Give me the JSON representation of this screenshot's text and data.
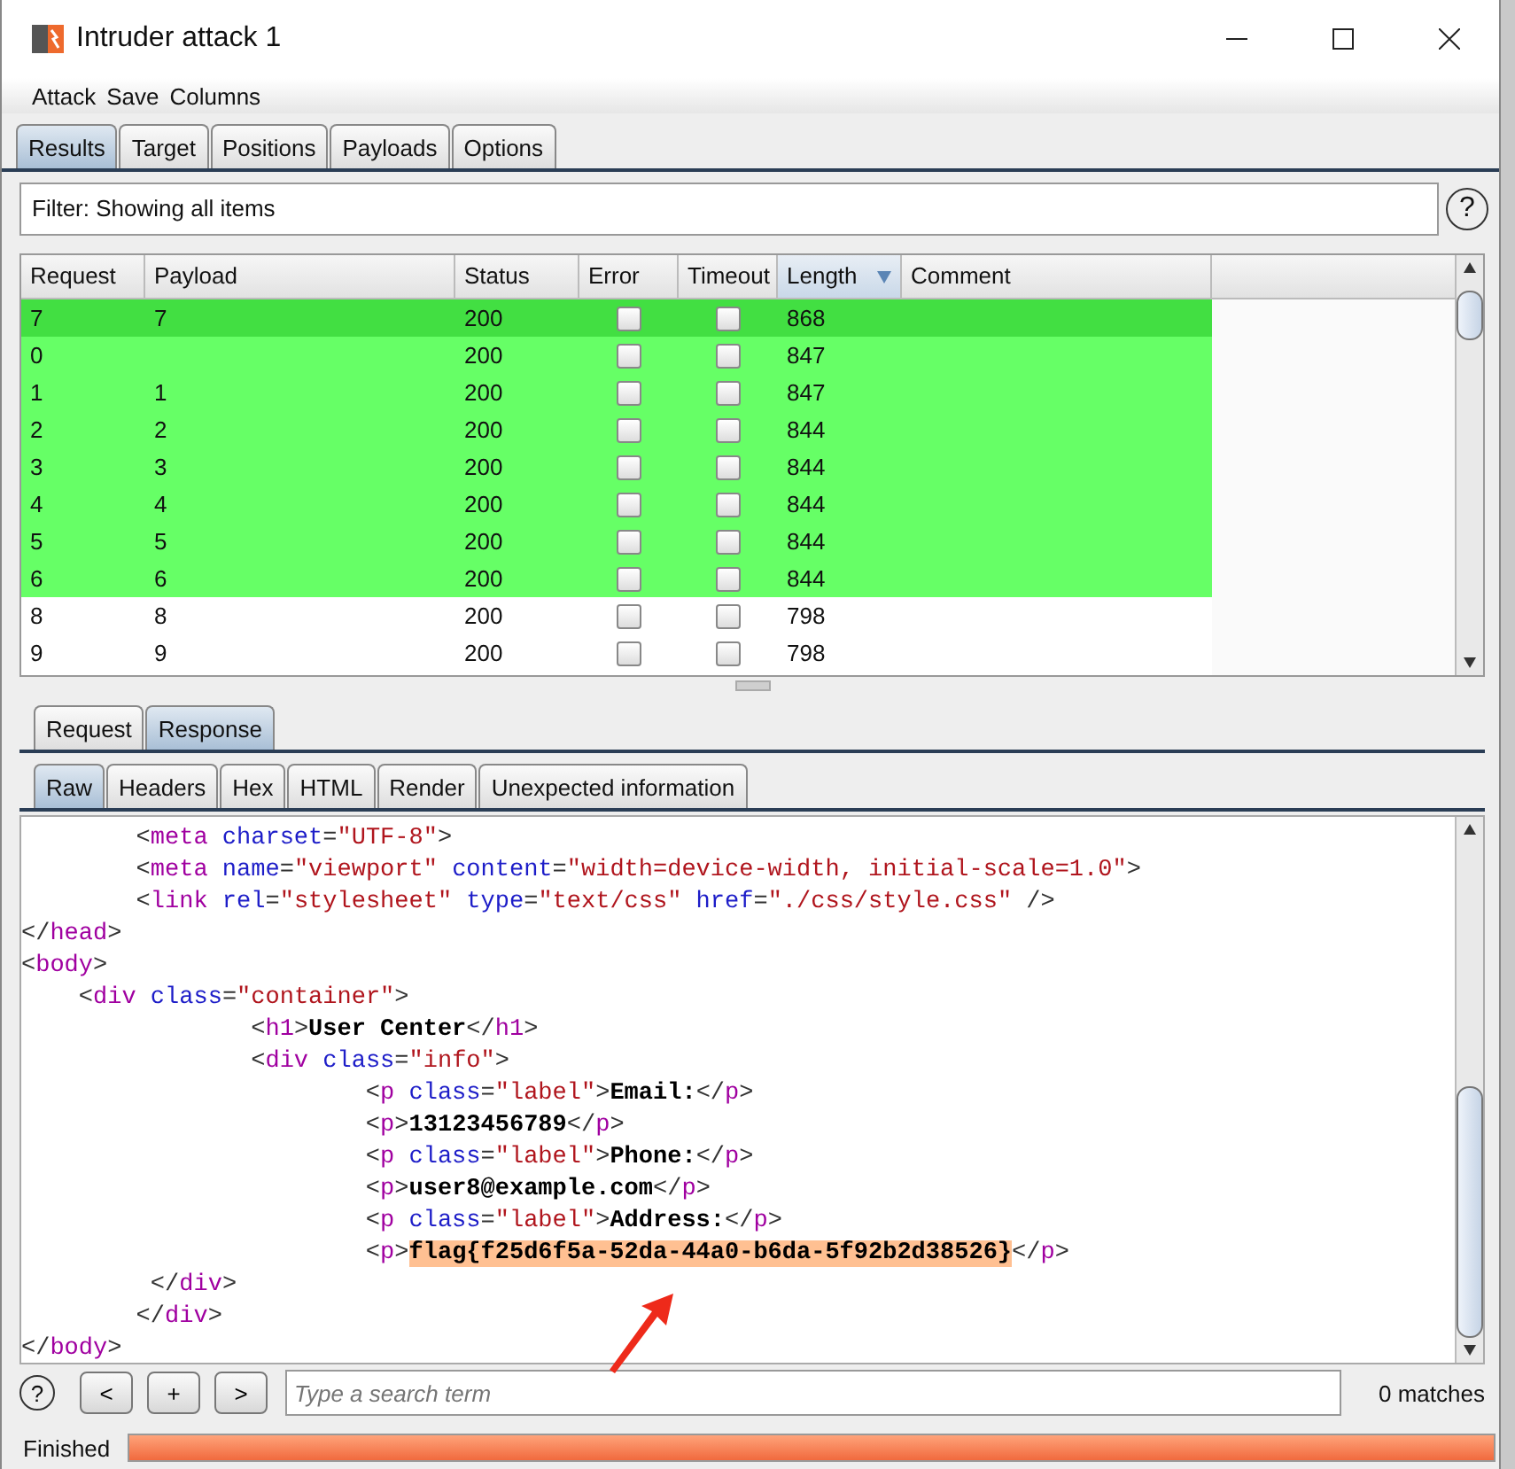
{
  "window": {
    "title": "Intruder attack 1"
  },
  "menu": [
    "Attack",
    "Save",
    "Columns"
  ],
  "tabs": [
    {
      "label": "Results",
      "selected": true
    },
    {
      "label": "Target",
      "selected": false
    },
    {
      "label": "Positions",
      "selected": false
    },
    {
      "label": "Payloads",
      "selected": false
    },
    {
      "label": "Options",
      "selected": false
    }
  ],
  "filter": {
    "text": "Filter: Showing all items",
    "help": "?"
  },
  "table": {
    "columns": [
      {
        "label": "Request",
        "sorted": false
      },
      {
        "label": "Payload",
        "sorted": false
      },
      {
        "label": "Status",
        "sorted": false
      },
      {
        "label": "Error",
        "sorted": false
      },
      {
        "label": "Timeout",
        "sorted": false
      },
      {
        "label": "Length",
        "sorted": true
      },
      {
        "label": "Comment",
        "sorted": false
      }
    ],
    "rows": [
      {
        "request": "7",
        "payload": "7",
        "status": "200",
        "error": false,
        "timeout": false,
        "length": "868",
        "color": "#42df42"
      },
      {
        "request": "0",
        "status": "200",
        "error": false,
        "timeout": false,
        "length": "847",
        "color": "#66ff66"
      },
      {
        "request": "1",
        "payload": "1",
        "status": "200",
        "error": false,
        "timeout": false,
        "length": "847",
        "color": "#66ff66"
      },
      {
        "request": "2",
        "payload": "2",
        "status": "200",
        "error": false,
        "timeout": false,
        "length": "844",
        "color": "#66ff66"
      },
      {
        "request": "3",
        "payload": "3",
        "status": "200",
        "error": false,
        "timeout": false,
        "length": "844",
        "color": "#66ff66"
      },
      {
        "request": "4",
        "payload": "4",
        "status": "200",
        "error": false,
        "timeout": false,
        "length": "844",
        "color": "#66ff66"
      },
      {
        "request": "5",
        "payload": "5",
        "status": "200",
        "error": false,
        "timeout": false,
        "length": "844",
        "color": "#66ff66"
      },
      {
        "request": "6",
        "payload": "6",
        "status": "200",
        "error": false,
        "timeout": false,
        "length": "844",
        "color": "#66ff66"
      },
      {
        "request": "8",
        "payload": "8",
        "status": "200",
        "error": false,
        "timeout": false,
        "length": "798",
        "color": "#ffffff"
      },
      {
        "request": "9",
        "payload": "9",
        "status": "200",
        "error": false,
        "timeout": false,
        "length": "798",
        "color": "#ffffff"
      }
    ]
  },
  "message_tabs": [
    {
      "label": "Request",
      "selected": false
    },
    {
      "label": "Response",
      "selected": true
    }
  ],
  "view_tabs": [
    {
      "label": "Raw",
      "selected": true
    },
    {
      "label": "Headers",
      "selected": false
    },
    {
      "label": "Hex",
      "selected": false
    },
    {
      "label": "HTML",
      "selected": false
    },
    {
      "label": "Render",
      "selected": false
    },
    {
      "label": "Unexpected information",
      "selected": false
    }
  ],
  "code_lines": [
    [
      {
        "kind": "punct",
        "text": "        <"
      },
      {
        "kind": "tag",
        "text": "meta"
      },
      {
        "kind": "attr",
        "text": " charset"
      },
      {
        "kind": "punct",
        "text": "="
      },
      {
        "kind": "value",
        "text": "\"UTF-8\""
      },
      {
        "kind": "punct",
        "text": ">"
      }
    ],
    [
      {
        "kind": "punct",
        "text": "        <"
      },
      {
        "kind": "tag",
        "text": "meta"
      },
      {
        "kind": "attr",
        "text": " name"
      },
      {
        "kind": "punct",
        "text": "="
      },
      {
        "kind": "value",
        "text": "\"viewport\""
      },
      {
        "kind": "attr",
        "text": " content"
      },
      {
        "kind": "punct",
        "text": "="
      },
      {
        "kind": "value",
        "text": "\"width=device-width, initial-scale=1.0\""
      },
      {
        "kind": "punct",
        "text": ">"
      }
    ],
    [
      {
        "kind": "punct",
        "text": "        <"
      },
      {
        "kind": "tag",
        "text": "link"
      },
      {
        "kind": "attr",
        "text": " rel"
      },
      {
        "kind": "punct",
        "text": "="
      },
      {
        "kind": "value",
        "text": "\"stylesheet\""
      },
      {
        "kind": "attr",
        "text": " type"
      },
      {
        "kind": "punct",
        "text": "="
      },
      {
        "kind": "value",
        "text": "\"text/css\""
      },
      {
        "kind": "attr",
        "text": " href"
      },
      {
        "kind": "punct",
        "text": "="
      },
      {
        "kind": "value",
        "text": "\"./css/style.css\""
      },
      {
        "kind": "punct",
        "text": " />"
      }
    ],
    [
      {
        "kind": "punct",
        "text": "</"
      },
      {
        "kind": "tag",
        "text": "head"
      },
      {
        "kind": "punct",
        "text": ">"
      }
    ],
    [
      {
        "kind": "punct",
        "text": "<"
      },
      {
        "kind": "tag",
        "text": "body"
      },
      {
        "kind": "punct",
        "text": ">"
      }
    ],
    [
      {
        "kind": "punct",
        "text": "    <"
      },
      {
        "kind": "tag",
        "text": "div"
      },
      {
        "kind": "attr",
        "text": " class"
      },
      {
        "kind": "punct",
        "text": "="
      },
      {
        "kind": "value",
        "text": "\"container\""
      },
      {
        "kind": "punct",
        "text": ">"
      }
    ],
    [
      {
        "kind": "punct",
        "text": "                <"
      },
      {
        "kind": "tag",
        "text": "h1"
      },
      {
        "kind": "punct",
        "text": ">"
      },
      {
        "kind": "text",
        "text": "User Center"
      },
      {
        "kind": "punct",
        "text": "</"
      },
      {
        "kind": "tag",
        "text": "h1"
      },
      {
        "kind": "punct",
        "text": ">"
      }
    ],
    [
      {
        "kind": "punct",
        "text": "                <"
      },
      {
        "kind": "tag",
        "text": "div"
      },
      {
        "kind": "attr",
        "text": " class"
      },
      {
        "kind": "punct",
        "text": "="
      },
      {
        "kind": "value",
        "text": "\"info\""
      },
      {
        "kind": "punct",
        "text": ">"
      }
    ],
    [
      {
        "kind": "punct",
        "text": "                        <"
      },
      {
        "kind": "tag",
        "text": "p"
      },
      {
        "kind": "attr",
        "text": " class"
      },
      {
        "kind": "punct",
        "text": "="
      },
      {
        "kind": "value",
        "text": "\"label\""
      },
      {
        "kind": "punct",
        "text": ">"
      },
      {
        "kind": "text",
        "text": "Email:"
      },
      {
        "kind": "punct",
        "text": "</"
      },
      {
        "kind": "tag",
        "text": "p"
      },
      {
        "kind": "punct",
        "text": ">"
      }
    ],
    [
      {
        "kind": "punct",
        "text": "                        <"
      },
      {
        "kind": "tag",
        "text": "p"
      },
      {
        "kind": "punct",
        "text": ">"
      },
      {
        "kind": "text",
        "text": "13123456789"
      },
      {
        "kind": "punct",
        "text": "</"
      },
      {
        "kind": "tag",
        "text": "p"
      },
      {
        "kind": "punct",
        "text": ">"
      }
    ],
    [
      {
        "kind": "punct",
        "text": "                        <"
      },
      {
        "kind": "tag",
        "text": "p"
      },
      {
        "kind": "attr",
        "text": " class"
      },
      {
        "kind": "punct",
        "text": "="
      },
      {
        "kind": "value",
        "text": "\"label\""
      },
      {
        "kind": "punct",
        "text": ">"
      },
      {
        "kind": "text",
        "text": "Phone:"
      },
      {
        "kind": "punct",
        "text": "</"
      },
      {
        "kind": "tag",
        "text": "p"
      },
      {
        "kind": "punct",
        "text": ">"
      }
    ],
    [
      {
        "kind": "punct",
        "text": "                        <"
      },
      {
        "kind": "tag",
        "text": "p"
      },
      {
        "kind": "punct",
        "text": ">"
      },
      {
        "kind": "text",
        "text": "user8@example.com"
      },
      {
        "kind": "punct",
        "text": "</"
      },
      {
        "kind": "tag",
        "text": "p"
      },
      {
        "kind": "punct",
        "text": ">"
      }
    ],
    [
      {
        "kind": "punct",
        "text": "                        <"
      },
      {
        "kind": "tag",
        "text": "p"
      },
      {
        "kind": "attr",
        "text": " class"
      },
      {
        "kind": "punct",
        "text": "="
      },
      {
        "kind": "value",
        "text": "\"label\""
      },
      {
        "kind": "punct",
        "text": ">"
      },
      {
        "kind": "text",
        "text": "Address:"
      },
      {
        "kind": "punct",
        "text": "</"
      },
      {
        "kind": "tag",
        "text": "p"
      },
      {
        "kind": "punct",
        "text": ">"
      }
    ],
    [
      {
        "kind": "punct",
        "text": "                        <"
      },
      {
        "kind": "tag",
        "text": "p"
      },
      {
        "kind": "punct",
        "text": ">"
      },
      {
        "kind": "match",
        "text": "flag{f25d6f5a-52da-44a0-b6da-5f92b2d38526}"
      },
      {
        "kind": "punct",
        "text": "</"
      },
      {
        "kind": "tag",
        "text": "p"
      },
      {
        "kind": "punct",
        "text": ">"
      }
    ],
    [
      {
        "kind": "punct",
        "text": "         </"
      },
      {
        "kind": "tag",
        "text": "div"
      },
      {
        "kind": "punct",
        "text": ">"
      }
    ],
    [
      {
        "kind": "punct",
        "text": "        </"
      },
      {
        "kind": "tag",
        "text": "div"
      },
      {
        "kind": "punct",
        "text": ">"
      }
    ],
    [
      {
        "kind": "punct",
        "text": "</"
      },
      {
        "kind": "tag",
        "text": "body"
      },
      {
        "kind": "punct",
        "text": ">"
      }
    ]
  ],
  "search": {
    "help": "?",
    "buttons": [
      "<",
      "+",
      ">"
    ],
    "placeholder": "Type a search term",
    "matches": "0 matches"
  },
  "status_bar": {
    "text": "Finished",
    "level": 1
  }
}
